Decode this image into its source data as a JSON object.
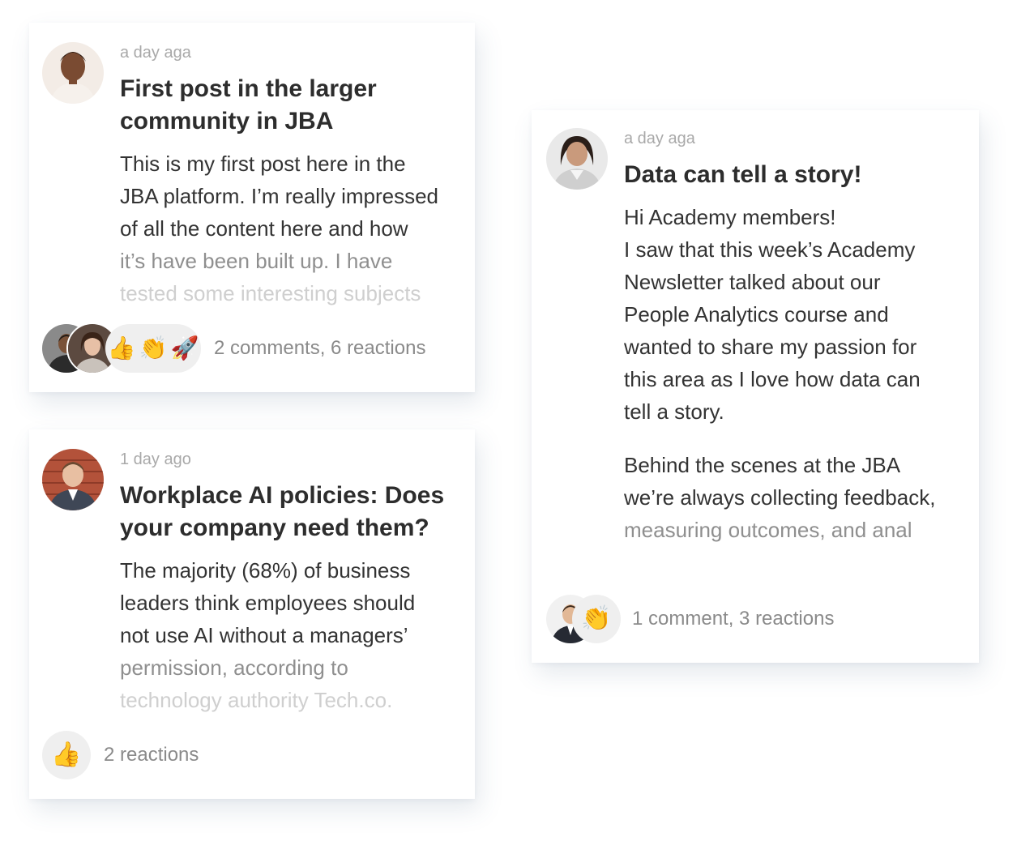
{
  "posts": [
    {
      "time": "a day aga",
      "title_line1": "First post in the larger",
      "title_line2": "community in JBA",
      "body": [
        "This is my first post here in the",
        "JBA platform. I’m really impressed",
        "of all the content here and how",
        "it’s have been built up. I have",
        "tested some interesting subjects"
      ],
      "reactions": [
        "thumbs-up",
        "clapping-hands",
        "rocket"
      ],
      "summary": "2 comments, 6 reactions"
    },
    {
      "time": "1 day ago",
      "title_line1": "Workplace AI policies: Does",
      "title_line2": "your company need them?",
      "body": [
        "The majority (68%) of business",
        "leaders think employees should",
        "not use AI without a managers’",
        "permission, according to",
        "technology authority Tech.co."
      ],
      "reactions": [
        "thumbs-up"
      ],
      "summary": "2 reactions"
    },
    {
      "time": "a day aga",
      "title_line1": "Data can tell a story!",
      "body": [
        "Hi Academy members!",
        "I saw that this week’s Academy",
        "Newsletter talked about our",
        "People Analytics course and",
        "wanted to share my passion for",
        "this area as I love how data can",
        "tell a story.",
        "Behind the scenes at the JBA",
        "we’re always collecting feedback,",
        "measuring outcomes, and anal"
      ],
      "reactions": [
        "clapping-hands"
      ],
      "summary": "1 comment, 3 reactions"
    }
  ],
  "emoji": {
    "thumbs-up": "👍",
    "clapping-hands": "👏",
    "rocket": "🚀"
  }
}
